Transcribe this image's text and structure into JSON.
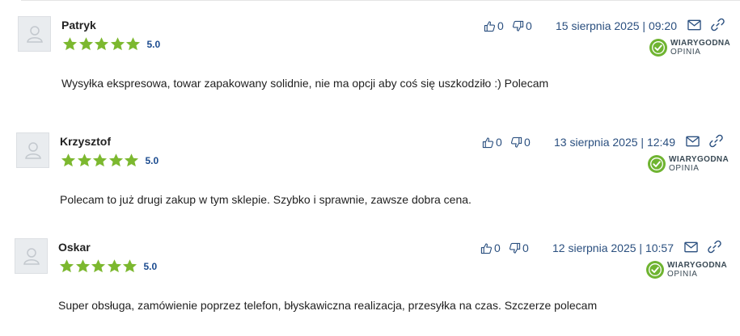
{
  "colors": {
    "star": "#7cb82f",
    "score": "#1b4b8f",
    "meta": "#2a4f7f",
    "badge_green": "#6fb431"
  },
  "icons": {
    "avatar": "user-silhouette-icon",
    "star": "star-icon",
    "up": "thumbs-up-icon",
    "down": "thumbs-down-icon",
    "mail": "envelope-icon",
    "link": "chain-link-icon",
    "badge": "verified-check-badge-icon"
  },
  "badge": {
    "line1": "WIARYGODNA",
    "line2": "OPINIA"
  },
  "reviews": [
    {
      "author": "Patryk",
      "rating": 5,
      "score": "5.0",
      "up": "0",
      "down": "0",
      "date": "15 sierpnia 2025 | 09:20",
      "text": "Wysyłka ekspresowa, towar zapakowany solidnie, nie ma opcji aby coś się uszkodziło :) Polecam"
    },
    {
      "author": "Krzysztof",
      "rating": 5,
      "score": "5.0",
      "up": "0",
      "down": "0",
      "date": "13 sierpnia 2025 | 12:49",
      "text": "Polecam to już drugi zakup w tym sklepie. Szybko i sprawnie, zawsze dobra cena."
    },
    {
      "author": "Oskar",
      "rating": 5,
      "score": "5.0",
      "up": "0",
      "down": "0",
      "date": "12 sierpnia 2025 | 10:57",
      "text": "Super obsługa, zamówienie poprzez telefon, błyskawiczna realizacja, przesyłka na czas. Szczerze polecam"
    }
  ]
}
